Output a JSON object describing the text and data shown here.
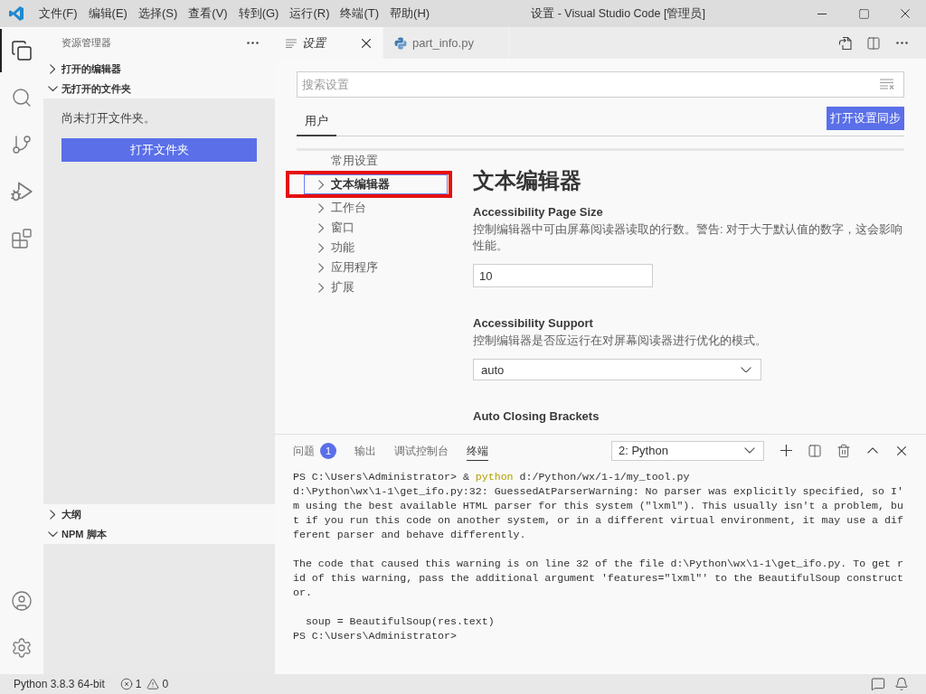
{
  "window": {
    "title": "设置 - Visual Studio Code [管理员]"
  },
  "menu": [
    "文件(F)",
    "编辑(E)",
    "选择(S)",
    "查看(V)",
    "转到(G)",
    "运行(R)",
    "终端(T)",
    "帮助(H)"
  ],
  "activity_bar": {
    "items": [
      {
        "kind": "files",
        "selected": true
      },
      {
        "kind": "search",
        "selected": false
      },
      {
        "kind": "source-control",
        "selected": false
      },
      {
        "kind": "run",
        "selected": false
      },
      {
        "kind": "extensions",
        "selected": false
      }
    ]
  },
  "sidebar": {
    "title": "资源管理器",
    "sections": [
      {
        "label": "打开的编辑器",
        "expanded": false
      },
      {
        "label": "无打开的文件夹",
        "expanded": true,
        "message": "尚未打开文件夹。",
        "button": "打开文件夹"
      },
      {
        "label": "大纲",
        "expanded": false
      },
      {
        "label": "NPM 脚本",
        "expanded": true
      }
    ]
  },
  "editor": {
    "tabs": [
      {
        "label": "设置",
        "kind": "settings",
        "selected": true,
        "preview": true
      },
      {
        "label": "part_info.py",
        "kind": "python",
        "selected": false,
        "preview": false
      }
    ]
  },
  "settings": {
    "search": {
      "placeholder": "搜索设置"
    },
    "targets": [
      {
        "label": "用户",
        "selected": true
      }
    ],
    "sync_button": "打开设置同步",
    "toc": [
      {
        "label": "常用设置",
        "kind": "leaf",
        "selected": false,
        "highlighted": false
      },
      {
        "label": "文本编辑器",
        "kind": "group",
        "selected": true,
        "highlighted": true
      },
      {
        "label": "工作台",
        "kind": "group",
        "selected": false,
        "highlighted": false
      },
      {
        "label": "窗口",
        "kind": "group",
        "selected": false,
        "highlighted": false
      },
      {
        "label": "功能",
        "kind": "group",
        "selected": false,
        "highlighted": false
      },
      {
        "label": "应用程序",
        "kind": "group",
        "selected": false,
        "highlighted": false
      },
      {
        "label": "扩展",
        "kind": "group",
        "selected": false,
        "highlighted": false
      }
    ],
    "section_title": "文本编辑器",
    "items": [
      {
        "title": "Accessibility Page Size",
        "description": "控制编辑器中可由屏幕阅读器读取的行数。警告: 对于大于默认值的数字，这会影响性能。",
        "kind": "number",
        "value": "10"
      },
      {
        "title": "Accessibility Support",
        "description": "控制编辑器是否应运行在对屏幕阅读器进行优化的模式。",
        "kind": "select",
        "value": "auto"
      },
      {
        "title": "Auto Closing Brackets",
        "kind": "heading"
      }
    ]
  },
  "panel": {
    "tabs": [
      {
        "label": "问题",
        "selected": false,
        "badge": "1"
      },
      {
        "label": "输出",
        "selected": false
      },
      {
        "label": "调试控制台",
        "selected": false
      },
      {
        "label": "终端",
        "selected": true
      }
    ],
    "terminal_select": "2: Python",
    "terminal": {
      "lines": [
        {
          "kind": "command",
          "prompt": "PS C:\\Users\\Administrator>",
          "operator": "&",
          "program": "python",
          "args": "d:/Python/wx/1-1/my_tool.py"
        },
        {
          "kind": "output",
          "text": "d:\\Python\\wx\\1-1\\get_ifo.py:32: GuessedAtParserWarning: No parser was explicitly specified, so I'"
        },
        {
          "kind": "output",
          "text": "m using the best available HTML parser for this system (\"lxml\"). This usually isn't a problem, bu"
        },
        {
          "kind": "output",
          "text": "t if you run this code on another system, or in a different virtual environment, it may use a dif"
        },
        {
          "kind": "output",
          "text": "ferent parser and behave differently."
        },
        {
          "kind": "blank"
        },
        {
          "kind": "output",
          "text": "The code that caused this warning is on line 32 of the file d:\\Python\\wx\\1-1\\get_ifo.py. To get r"
        },
        {
          "kind": "output",
          "text": "id of this warning, pass the additional argument 'features=\"lxml\"' to the BeautifulSoup construct"
        },
        {
          "kind": "output",
          "text": "or."
        },
        {
          "kind": "blank"
        },
        {
          "kind": "output",
          "text": "  soup = BeautifulSoup(res.text)"
        },
        {
          "kind": "output",
          "text": "PS C:\\Users\\Administrator>"
        }
      ]
    }
  },
  "status_bar": {
    "interpreter": "Python 3.8.3 64-bit",
    "errors": "1",
    "warnings": "0"
  }
}
